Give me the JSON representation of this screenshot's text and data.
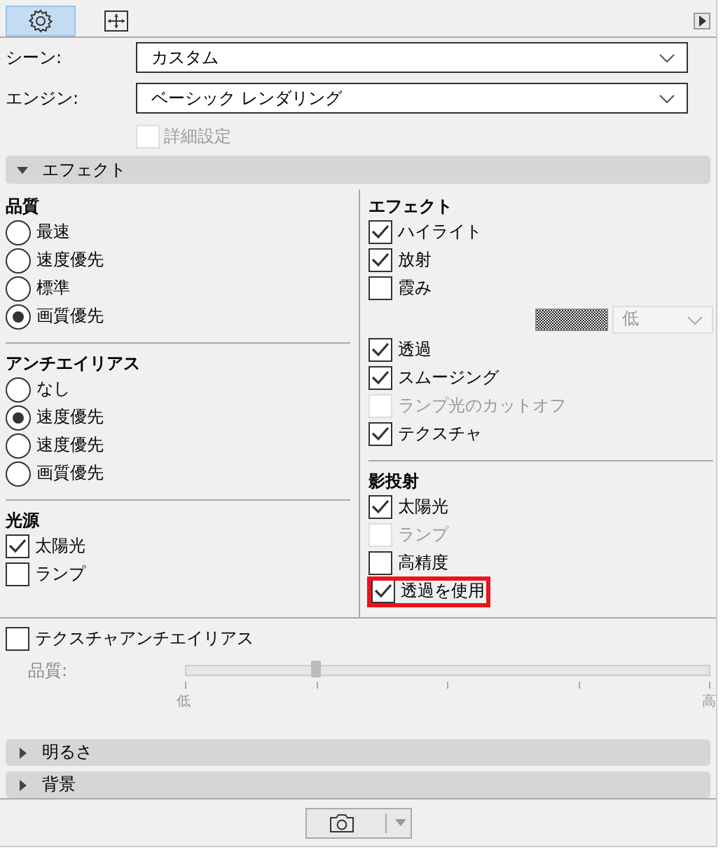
{
  "toolbar": {
    "tabs": [
      {
        "kind": "settings",
        "selected": true
      },
      {
        "kind": "layout",
        "selected": false
      }
    ]
  },
  "fields": [
    {
      "label": "シーン:",
      "value": "カスタム"
    },
    {
      "label": "エンジン:",
      "value": "ベーシック レンダリング"
    }
  ],
  "advanced": {
    "label": "詳細設定",
    "checked": false,
    "disabled": true
  },
  "effects_section": {
    "title": "エフェクト",
    "expanded": true
  },
  "left_groups": [
    {
      "title": "品質",
      "items": [
        {
          "kind": "radio",
          "label": "最速",
          "selected": false
        },
        {
          "kind": "radio",
          "label": "速度優先",
          "selected": false
        },
        {
          "kind": "radio",
          "label": "標準",
          "selected": false
        },
        {
          "kind": "radio",
          "label": "画質優先",
          "selected": true
        }
      ]
    },
    {
      "title": "アンチエイリアス",
      "items": [
        {
          "kind": "radio",
          "label": "なし",
          "selected": false
        },
        {
          "kind": "radio",
          "label": "速度優先",
          "selected": true
        },
        {
          "kind": "radio",
          "label": "速度優先",
          "selected": false
        },
        {
          "kind": "radio",
          "label": "画質優先",
          "selected": false
        }
      ]
    },
    {
      "title": "光源",
      "items": [
        {
          "kind": "checkbox",
          "label": "太陽光",
          "checked": true,
          "disabled": false
        },
        {
          "kind": "checkbox",
          "label": "ランプ",
          "checked": false,
          "disabled": false
        }
      ]
    }
  ],
  "right_groups": [
    {
      "title": "エフェクト",
      "items": [
        {
          "kind": "checkbox",
          "label": "ハイライト",
          "checked": true,
          "disabled": false
        },
        {
          "kind": "checkbox",
          "label": "放射",
          "checked": true,
          "disabled": false
        },
        {
          "kind": "checkbox",
          "label": "霞み",
          "checked": false,
          "disabled": false
        },
        {
          "kind": "swatch-select",
          "value": "低",
          "disabled": true
        },
        {
          "kind": "checkbox",
          "label": "透過",
          "checked": true,
          "disabled": false
        },
        {
          "kind": "checkbox",
          "label": "スムージング",
          "checked": true,
          "disabled": false
        },
        {
          "kind": "checkbox",
          "label": "ランプ光のカットオフ",
          "checked": false,
          "disabled": true
        },
        {
          "kind": "checkbox",
          "label": "テクスチャ",
          "checked": true,
          "disabled": false
        }
      ]
    },
    {
      "title": "影投射",
      "items": [
        {
          "kind": "checkbox",
          "label": "太陽光",
          "checked": true,
          "disabled": false
        },
        {
          "kind": "checkbox",
          "label": "ランプ",
          "checked": false,
          "disabled": true
        },
        {
          "kind": "checkbox",
          "label": "高精度",
          "checked": false,
          "disabled": false
        },
        {
          "kind": "checkbox",
          "label": "透過を使用",
          "checked": true,
          "disabled": false,
          "highlighted": true
        }
      ]
    }
  ],
  "texture_aa": {
    "label": "テクスチャアンチエイリアス",
    "checked": false
  },
  "quality_slider": {
    "label": "品質:",
    "level": 0.25,
    "disabled": true,
    "min_label": "低",
    "max_label": "高"
  },
  "collapsed_sections": [
    {
      "title": "明るさ",
      "expanded": false
    },
    {
      "title": "背景",
      "expanded": false
    }
  ]
}
